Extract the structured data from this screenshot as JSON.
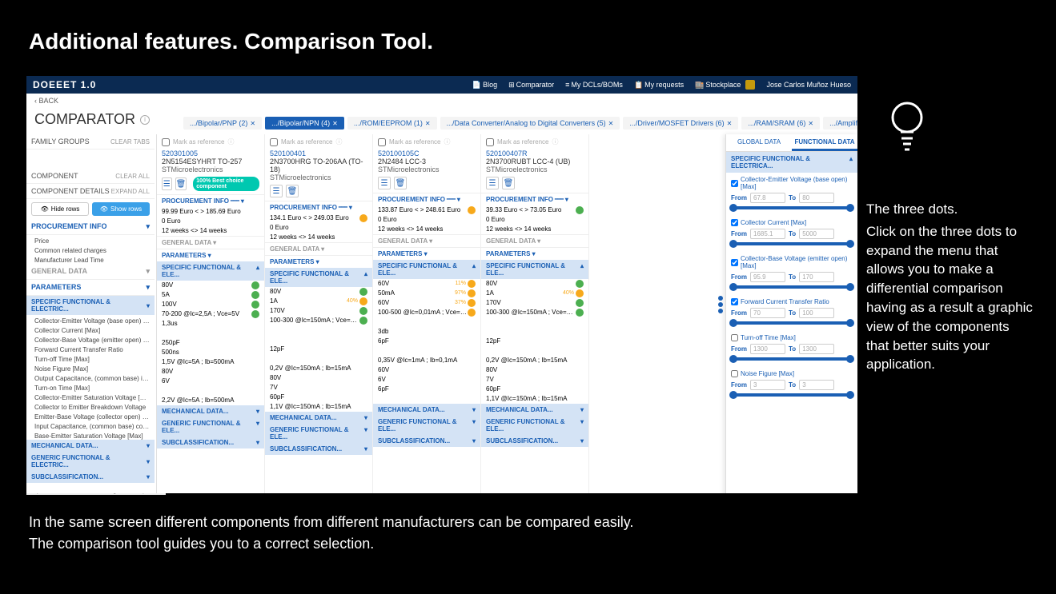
{
  "slide": {
    "title": "Additional features. Comparison Tool.",
    "side_text_1": "The three dots.",
    "side_text_2": "Click on the three dots to expand the menu that allows you to make a differential comparison having as a result a graphic view of the components that better suits your application.",
    "bottom_1": "In the same screen different components from different manufacturers can be compared easily.",
    "bottom_2": "The comparison tool guides you to a correct selection."
  },
  "header": {
    "logo": "DOEEET 1.0",
    "links": [
      "Blog",
      "Comparator",
      "My DCLs/BOMs",
      "My requests",
      "Stockplace"
    ],
    "user": "Jose Carlos Muñoz Hueso"
  },
  "back": "BACK",
  "page_title": "COMPARATOR",
  "tabs": [
    {
      "label": ".../Bipolar/PNP (2)",
      "active": false
    },
    {
      "label": ".../Bipolar/NPN (4)",
      "active": true
    },
    {
      "label": ".../ROM/EEPROM (1)",
      "active": false
    },
    {
      "label": ".../Data Converter/Analog to Digital Converters (5)",
      "active": false
    },
    {
      "label": ".../Driver/MOSFET Drivers (6)",
      "active": false
    },
    {
      "label": ".../RAM/SRAM (6)",
      "active": false
    },
    {
      "label": ".../Amplifier/Operational Amplifi",
      "active": false
    }
  ],
  "left": {
    "family_groups": "FAMILY GROUPS",
    "clear_tabs": "CLEAR TABS",
    "component": "COMPONENT",
    "clear_all": "CLEAR ALL",
    "component_details": "COMPONENT DETAILS",
    "expand_all": "EXPAND ALL",
    "hide_rows": "Hide rows",
    "show_rows": "Show rows",
    "procurement": "PROCUREMENT INFO",
    "proc_items": [
      "Price",
      "Common related charges",
      "Manufacturer Lead Time"
    ],
    "general": "GENERAL DATA",
    "parameters": "PARAMETERS",
    "spec_func": "SPECIFIC FUNCTIONAL & ELECTRIC...",
    "params": [
      "Collector-Emitter Voltage (base open) [Max]",
      "Collector Current [Max]",
      "Collector-Base Voltage (emitter open) [Max]",
      "Forward Current Transfer Ratio",
      "Turn-off Time [Max]",
      "Noise Figure [Max]",
      "Output Capacitance, (common base) input o...",
      "Turn-on Time [Max]",
      "Collector-Emitter Saturation Voltage [Max]",
      "Collector to Emitter Breakdown Voltage",
      "Emitter-Base Voltage (collector open) [Max]",
      "Input Capacitance, (common base) collector ...",
      "Base-Emitter Saturation Voltage [Max]"
    ],
    "mech": "MECHANICAL DATA...",
    "gen_func": "GENERIC FUNCTIONAL & ELECTRIC...",
    "subclass": "SUBCLASSIFICATION..."
  },
  "cols": [
    {
      "num": "520301005",
      "name": "2N5154ESYHRT TO-257",
      "mfr": "STMicroelectronics",
      "best": "100% Best choice component",
      "proc": [
        "99.99 Euro < > 185.69 Euro",
        "0 Euro",
        "12 weeks <> 14 weeks"
      ],
      "vals": [
        {
          "v": "80V",
          "i": "g"
        },
        {
          "v": "5A",
          "i": "g"
        },
        {
          "v": "100V",
          "i": "g"
        },
        {
          "v": "70-200 @Ic=2,5A ; Vce=5V",
          "i": "g"
        },
        {
          "v": "1,3us"
        },
        {
          "v": ""
        },
        {
          "v": "250pF"
        },
        {
          "v": "500ns"
        },
        {
          "v": "1,5V @Ic=5A ; Ib=500mA"
        },
        {
          "v": "80V"
        },
        {
          "v": "6V"
        },
        {
          "v": ""
        },
        {
          "v": "2,2V @Ic=5A ; Ib=500mA"
        }
      ]
    },
    {
      "num": "520100401",
      "name": "2N3700HRG TO-206AA (TO-18)",
      "mfr": "STMicroelectronics",
      "proc": [
        "134.1 Euro < > 249.03 Euro",
        "0 Euro",
        "12 weeks <> 14 weeks"
      ],
      "proc_ind": "o",
      "vals": [
        {
          "v": "80V",
          "i": "g"
        },
        {
          "v": "1A",
          "p": "40%",
          "i": "o"
        },
        {
          "v": "170V",
          "i": "g"
        },
        {
          "v": "100-300 @Ic=150mA ; Vce=10V",
          "i": "g"
        },
        {
          "v": ""
        },
        {
          "v": ""
        },
        {
          "v": "12pF"
        },
        {
          "v": ""
        },
        {
          "v": "0,2V @Ic=150mA ; Ib=15mA"
        },
        {
          "v": "80V"
        },
        {
          "v": "7V"
        },
        {
          "v": "60pF"
        },
        {
          "v": "1,1V @Ic=150mA ; Ib=15mA"
        }
      ]
    },
    {
      "num": "520100105C",
      "name": "2N2484 LCC-3",
      "mfr": "STMicroelectronics",
      "proc": [
        "133.87 Euro < > 248.61 Euro",
        "0 Euro",
        "12 weeks <> 14 weeks"
      ],
      "proc_ind": "o",
      "vals": [
        {
          "v": "60V",
          "p": "11%",
          "i": "o"
        },
        {
          "v": "50mA",
          "p": "97%",
          "i": "o"
        },
        {
          "v": "60V",
          "p": "37%",
          "i": "o"
        },
        {
          "v": "100-500 @Ic=0,01mA ; Vce=5V",
          "i": "o"
        },
        {
          "v": ""
        },
        {
          "v": "3db"
        },
        {
          "v": "6pF"
        },
        {
          "v": ""
        },
        {
          "v": "0,35V @Ic=1mA ; Ib=0,1mA"
        },
        {
          "v": "60V"
        },
        {
          "v": "6V"
        },
        {
          "v": "6pF"
        },
        {
          "v": ""
        }
      ]
    },
    {
      "num": "520100407R",
      "name": "2N3700RUBT LCC-4 (UB)",
      "mfr": "STMicroelectronics",
      "proc": [
        "39.33 Euro < > 73.05 Euro",
        "0 Euro",
        "12 weeks <> 14 weeks"
      ],
      "proc_ind": "g",
      "vals": [
        {
          "v": "80V",
          "i": "g"
        },
        {
          "v": "1A",
          "p": "40%",
          "i": "o"
        },
        {
          "v": "170V",
          "i": "g"
        },
        {
          "v": "100-300 @Ic=150mA ; Vce=10V",
          "i": "g"
        },
        {
          "v": ""
        },
        {
          "v": ""
        },
        {
          "v": "12pF"
        },
        {
          "v": ""
        },
        {
          "v": "0,2V @Ic=150mA ; Ib=15mA"
        },
        {
          "v": "80V"
        },
        {
          "v": "7V"
        },
        {
          "v": "60pF"
        },
        {
          "v": "1,1V @Ic=150mA ; Ib=15mA"
        }
      ]
    }
  ],
  "col_sec": {
    "procurement": "PROCUREMENT INFO",
    "general": "GENERAL DATA",
    "parameters": "PARAMETERS",
    "spec": "SPECIFIC FUNCTIONAL & ELE...",
    "mech": "MECHANICAL DATA...",
    "gen": "GENERIC FUNCTIONAL & ELE...",
    "sub": "SUBCLASSIFICATION...",
    "mark": "Mark as reference"
  },
  "right": {
    "global": "GLOBAL DATA",
    "functional": "FUNCTIONAL DATA",
    "sec": "SPECIFIC FUNCTIONAL & ELECTRICA...",
    "params": [
      {
        "name": "Collector-Emitter Voltage (base open) [Max]",
        "from": "67.8",
        "to": "80",
        "chk": true
      },
      {
        "name": "Collector Current [Max]",
        "from": "1685.1",
        "to": "5000",
        "chk": true
      },
      {
        "name": "Collector-Base Voltage (emitter open) [Max]",
        "from": "95.9",
        "to": "170",
        "chk": true
      },
      {
        "name": "Forward Current Transfer Ratio",
        "from": "70",
        "to": "100",
        "chk": true
      },
      {
        "name": "Turn-off Time [Max]",
        "from": "1300",
        "to": "1300",
        "chk": false
      },
      {
        "name": "Noise Figure [Max]",
        "from": "3",
        "to": "3",
        "chk": false
      }
    ],
    "from": "From",
    "to": "To"
  },
  "status_url": "https://www.doeeet.com/web/guest/comparator"
}
